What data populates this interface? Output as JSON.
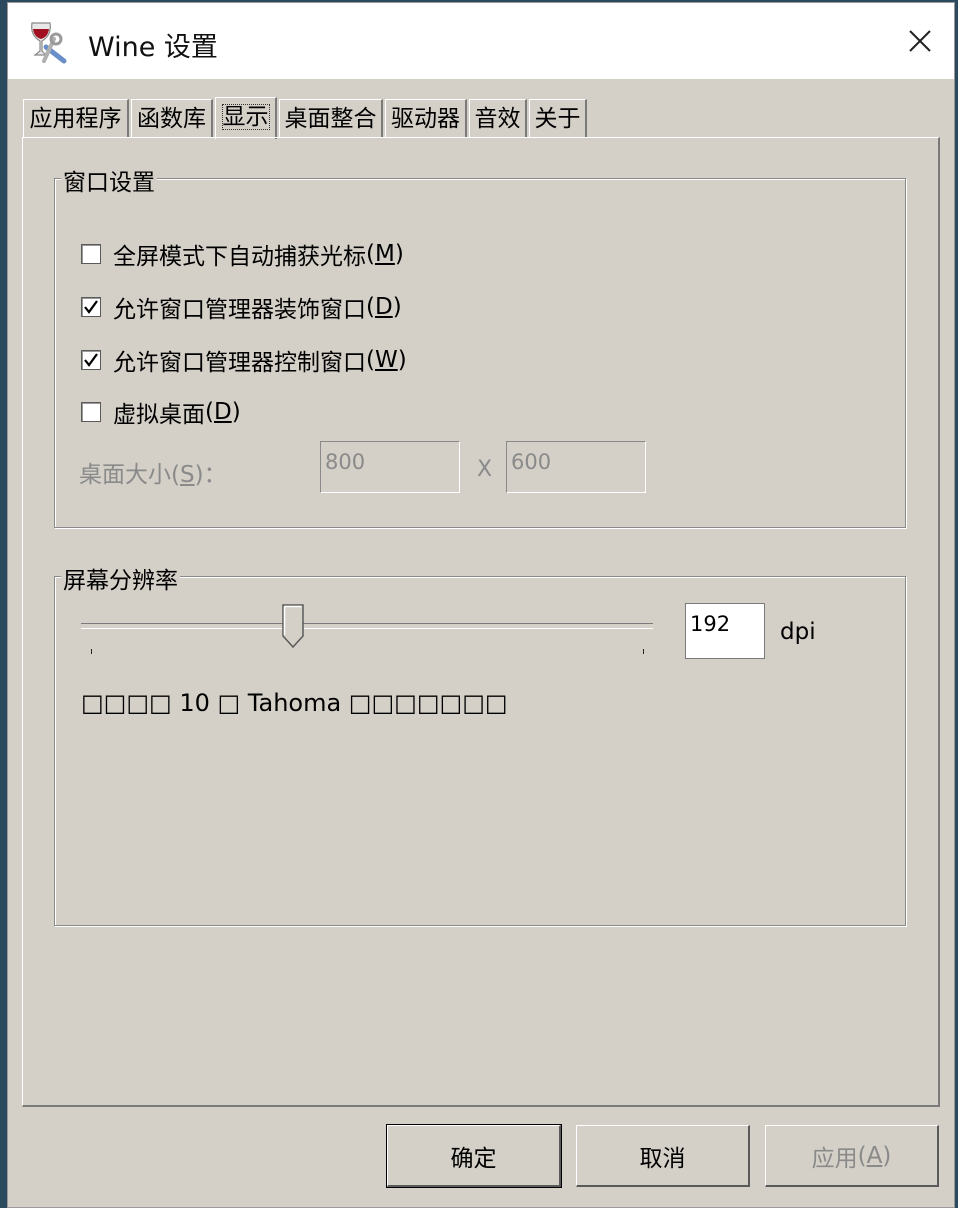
{
  "window": {
    "title": "Wine 设置"
  },
  "tabs": [
    {
      "label": "应用程序"
    },
    {
      "label": "函数库"
    },
    {
      "label": "显示"
    },
    {
      "label": "桌面整合"
    },
    {
      "label": "驱动器"
    },
    {
      "label": "音效"
    },
    {
      "label": "关于"
    }
  ],
  "active_tab": "显示",
  "window_settings": {
    "title": "窗口设置",
    "checkboxes": [
      {
        "label": "全屏模式下自动捕获光标",
        "mnemonic": "M",
        "checked": false
      },
      {
        "label": "允许窗口管理器装饰窗口",
        "mnemonic": "D",
        "checked": true
      },
      {
        "label": "允许窗口管理器控制窗口",
        "mnemonic": "W",
        "checked": true
      },
      {
        "label": "虚拟桌面",
        "mnemonic": "D",
        "checked": false
      }
    ],
    "desktop_size": {
      "label": "桌面大小",
      "mnemonic": "S",
      "suffix": "：",
      "width": "800",
      "separator": "X",
      "height": "600"
    }
  },
  "screen_resolution": {
    "title": "屏幕分辨率",
    "dpi_value": "192",
    "dpi_unit": "dpi",
    "slider_position": 0.37,
    "preview_text": "□□□□ 10 □ Tahoma □□□□□□□"
  },
  "buttons": {
    "ok": "确定",
    "cancel": "取消",
    "apply": {
      "label": "应用",
      "mnemonic": "A"
    }
  }
}
